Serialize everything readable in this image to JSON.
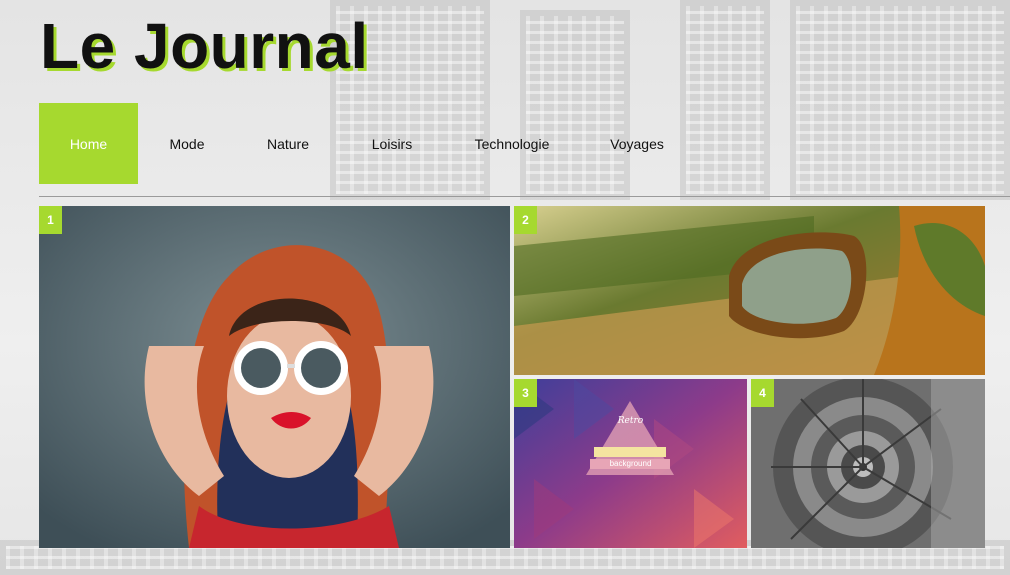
{
  "site": {
    "title": "Le Journal"
  },
  "nav": {
    "items": [
      {
        "label": "Home",
        "active": true
      },
      {
        "label": "Mode",
        "active": false
      },
      {
        "label": "Nature",
        "active": false
      },
      {
        "label": "Loisirs",
        "active": false
      },
      {
        "label": "Technologie",
        "active": false
      },
      {
        "label": "Voyages",
        "active": false
      }
    ]
  },
  "tiles": [
    {
      "number": "1"
    },
    {
      "number": "2"
    },
    {
      "number": "3",
      "overlay": {
        "line1": "Retro",
        "line2": "background"
      }
    },
    {
      "number": "4"
    }
  ],
  "colors": {
    "accent": "#a6d92f",
    "title_text": "#111111"
  }
}
